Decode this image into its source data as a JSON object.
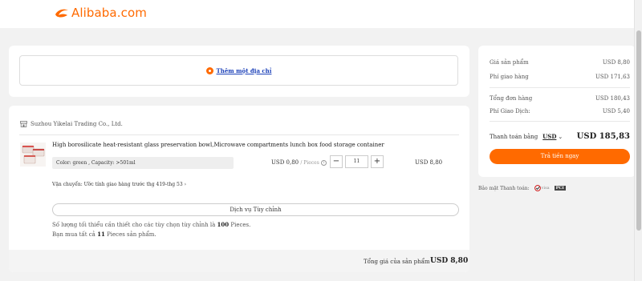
{
  "header": {
    "brand_text": "Alibaba.com",
    "brand_color": "#ff6a00",
    "logo_icon": "alibaba-logo-icon"
  },
  "address": {
    "add_label": "Thêm một địa chỉ",
    "icon": "location-pin-icon"
  },
  "order": {
    "seller": "Suzhou Yikelai Trading Co., Ltd.",
    "product_title": "High borosilicate heat-resistant glass preservation bowl,Microwave compartments lunch box food storage container",
    "variant": "Color: green , Capacity: >501ml",
    "unit_price": "USD 0,80",
    "unit_label": "/ Pieces",
    "quantity": "11",
    "line_total": "USD 8,80",
    "shipping": "Vận chuyển: Ước tính giao hàng trước thg 419-thg 53",
    "custom_service": "Dịch vụ Tùy chỉnh",
    "min_note_prefix": "Số lượng tối thiểu cần thiết cho các tùy chọn tùy chỉnh là",
    "min_note_qty": "100",
    "min_note_suffix": "Pieces.",
    "bought_prefix": "Bạn mua tất cả",
    "bought_qty": "11",
    "bought_suffix": "Pieces sản phẩm.",
    "subtotal_label": "Tổng giá của sản phẩm",
    "subtotal_value": "USD 8,80"
  },
  "summary": {
    "rows": [
      {
        "label": "Giá sản phẩm",
        "value": "USD 8,80"
      },
      {
        "label": "Phí giao hàng",
        "value": "USD 171,63"
      },
      {
        "label": "Tổng đơn hàng",
        "value": "USD 180,43"
      },
      {
        "label": "Phí Giao Dịch:",
        "value": "USD 5,40"
      }
    ],
    "pay_label": "Thanh toán bằng",
    "currency": "USD",
    "total": "USD 185,83",
    "pay_button": "Trả tiền ngay",
    "button_color": "#ff6a00"
  },
  "security": {
    "label": "Bảo mật Thanh toán:",
    "badge1": "visa",
    "badge2": "PCI"
  }
}
